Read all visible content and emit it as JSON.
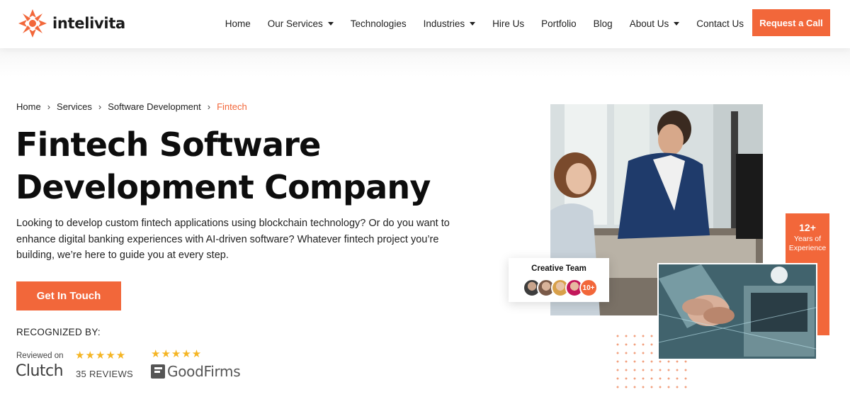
{
  "brand": {
    "name": "intelivita",
    "accent": "#f2673a"
  },
  "nav": {
    "items": [
      {
        "label": "Home",
        "dropdown": false
      },
      {
        "label": "Our Services",
        "dropdown": true
      },
      {
        "label": "Technologies",
        "dropdown": false
      },
      {
        "label": "Industries",
        "dropdown": true
      },
      {
        "label": "Hire Us",
        "dropdown": false
      },
      {
        "label": "Portfolio",
        "dropdown": false
      },
      {
        "label": "Blog",
        "dropdown": false
      },
      {
        "label": "About Us",
        "dropdown": true
      },
      {
        "label": "Contact Us",
        "dropdown": false
      }
    ],
    "cta": "Request a Call"
  },
  "breadcrumb": [
    "Home",
    "Services",
    "Software Development",
    "Fintech"
  ],
  "hero": {
    "title_line1": "Fintech Software",
    "title_line2": "Development Company",
    "description": "Looking to develop custom fintech applications using blockchain technology? Or do you want to enhance digital banking experiences with AI-driven software? Whatever fintech project you’re building, we’re here to guide you at every step.",
    "button": "Get In Touch"
  },
  "recognition": {
    "heading": "RECOGNIZED BY:",
    "clutch": {
      "reviewed_on": "Reviewed on",
      "logo": "Clutch",
      "reviews": "35 REVIEWS",
      "stars": "★★★★★"
    },
    "goodfirms": {
      "logo": "GoodFirms",
      "stars": "★★★★★"
    }
  },
  "experience_badge": {
    "number": "12+",
    "text_line1": "Years of",
    "text_line2": "Experience"
  },
  "team_card": {
    "title": "Creative Team",
    "count": "10+"
  }
}
